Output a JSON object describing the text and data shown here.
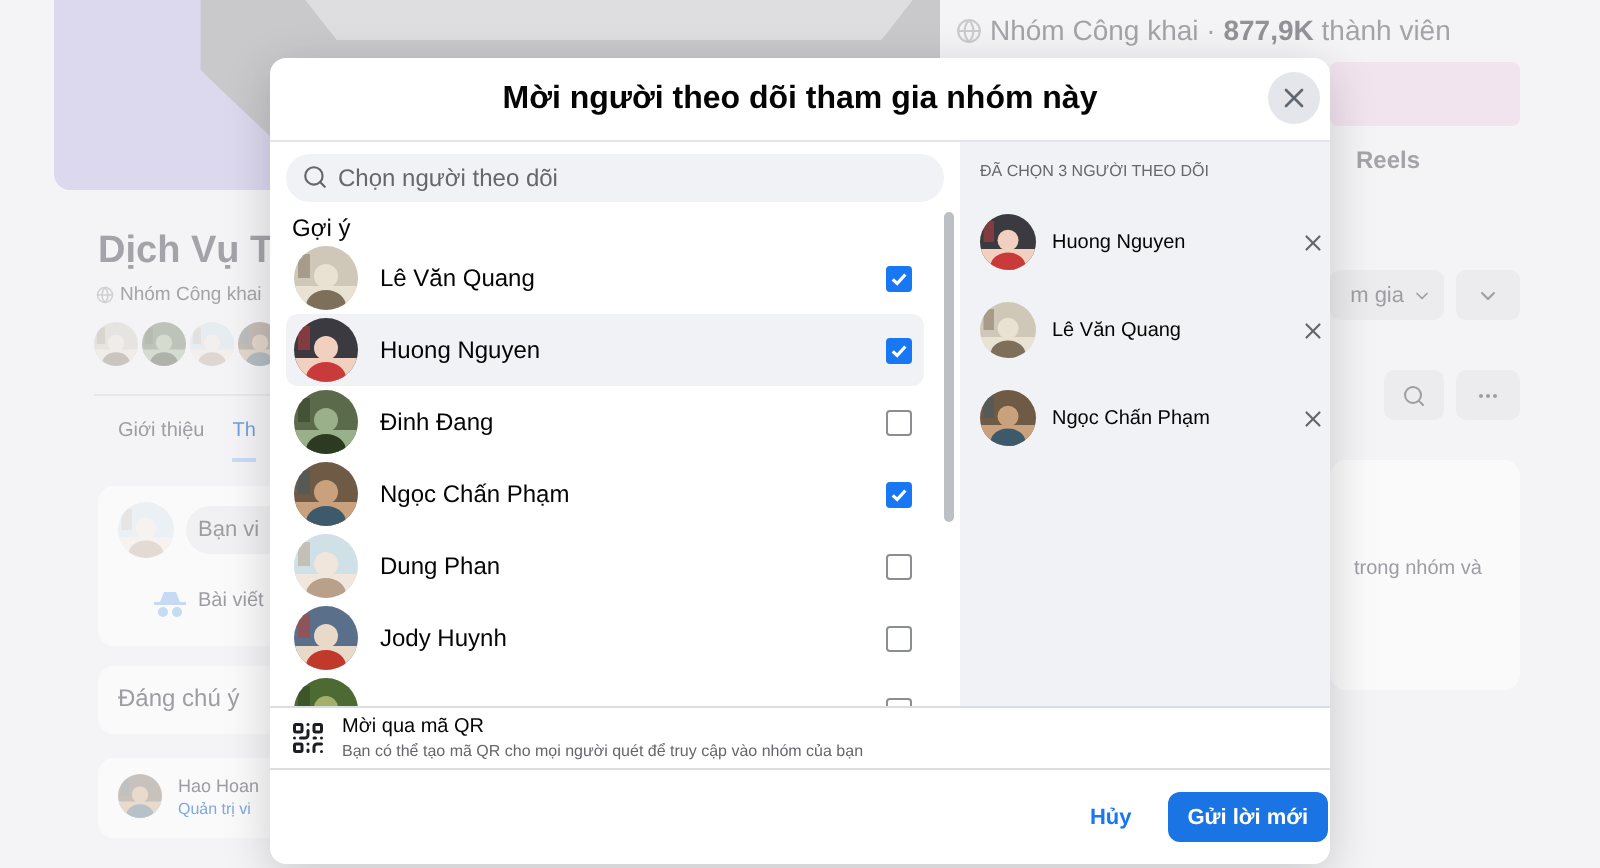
{
  "page": {
    "stats": "Nhóm Công khai · **877,9K** thành viên",
    "group_name": "Dịch Vụ T",
    "privacy": "Nhóm Công khai",
    "reels": "Reels",
    "join_button": "m gia",
    "tabs": [
      {
        "label": "Giới thiệu",
        "selected": false
      },
      {
        "label": "Th",
        "selected": true
      }
    ],
    "composer_placeholder": "Bạn vi",
    "anonymous_post": "Bài viết",
    "card_text": "trong nhóm và",
    "featured": "Đáng chú ý",
    "post_author": "Hao Hoan",
    "author_role": "Quản trị vi"
  },
  "dialog": {
    "title": "Mời người theo dõi tham gia nhóm này",
    "search": {
      "placeholder": "Chọn người theo dõi"
    },
    "section": "Gợi ý",
    "people": [
      {
        "name": "Lê Văn Quang",
        "checked": true,
        "hovered": false
      },
      {
        "name": "Huong Nguyen",
        "checked": true,
        "hovered": true
      },
      {
        "name": "Đinh Đang",
        "checked": false,
        "hovered": false
      },
      {
        "name": "Ngọc Chấn Phạm",
        "checked": true,
        "hovered": false
      },
      {
        "name": "Dung Phan",
        "checked": false,
        "hovered": false
      },
      {
        "name": "Jody Huynh",
        "checked": false,
        "hovered": false
      },
      {
        "checked": false,
        "hovered": false
      }
    ],
    "qr": {
      "title": "Mời qua mã QR",
      "description": "Bạn có thể tạo mã QR cho mọi người quét để truy cập vào nhóm của bạn"
    },
    "selected_header": "ĐÃ CHỌN 3 NGƯỜI THEO DÕI",
    "selected": [
      {
        "name": "Huong Nguyen"
      },
      {
        "name": "Lê Văn Quang"
      },
      {
        "name": "Ngọc Chấn Phạm"
      }
    ],
    "buttons": {
      "cancel": "Hủy",
      "send": "Gửi lời mới"
    }
  }
}
